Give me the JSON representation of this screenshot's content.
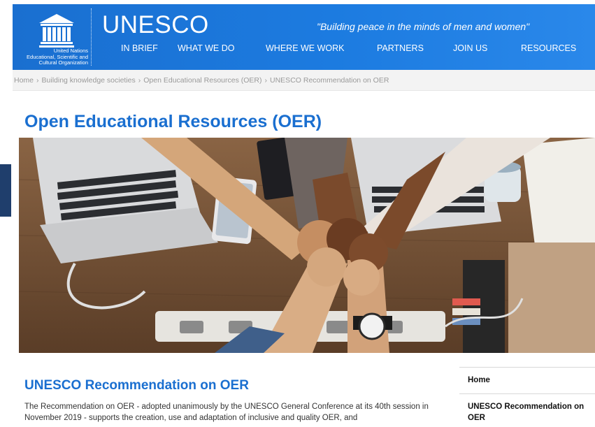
{
  "header": {
    "org_name": "United Nations\nEducational, Scientific and\nCultural Organization",
    "brand": "UNESCO",
    "motto": "\"Building peace in the minds of men and women\"",
    "nav": [
      {
        "label": "IN BRIEF"
      },
      {
        "label": "WHAT WE DO"
      },
      {
        "label": "WHERE WE WORK"
      },
      {
        "label": "PARTNERS"
      },
      {
        "label": "JOIN US"
      },
      {
        "label": "RESOURCES"
      }
    ],
    "colors": {
      "header_blue": "#1a6fd0",
      "title_blue": "#1a6fd0"
    }
  },
  "breadcrumb": [
    {
      "label": "Home"
    },
    {
      "label": "Building knowledge societies"
    },
    {
      "label": "Open Educational Resources (OER)"
    },
    {
      "label": "UNESCO Recommendation on OER"
    }
  ],
  "breadcrumb_separator": "›",
  "page": {
    "title": "Open Educational Resources (OER)",
    "section_title": "UNESCO Recommendation on OER",
    "body": "The Recommendation on OER - adopted unanimously by the UNESCO General Conference at its 40th session in November 2019 - supports the creation, use and adaptation of inclusive and quality OER, and"
  },
  "sidebar": {
    "items": [
      {
        "label": "Home"
      },
      {
        "label": "UNESCO Recommendation on OER"
      }
    ]
  }
}
